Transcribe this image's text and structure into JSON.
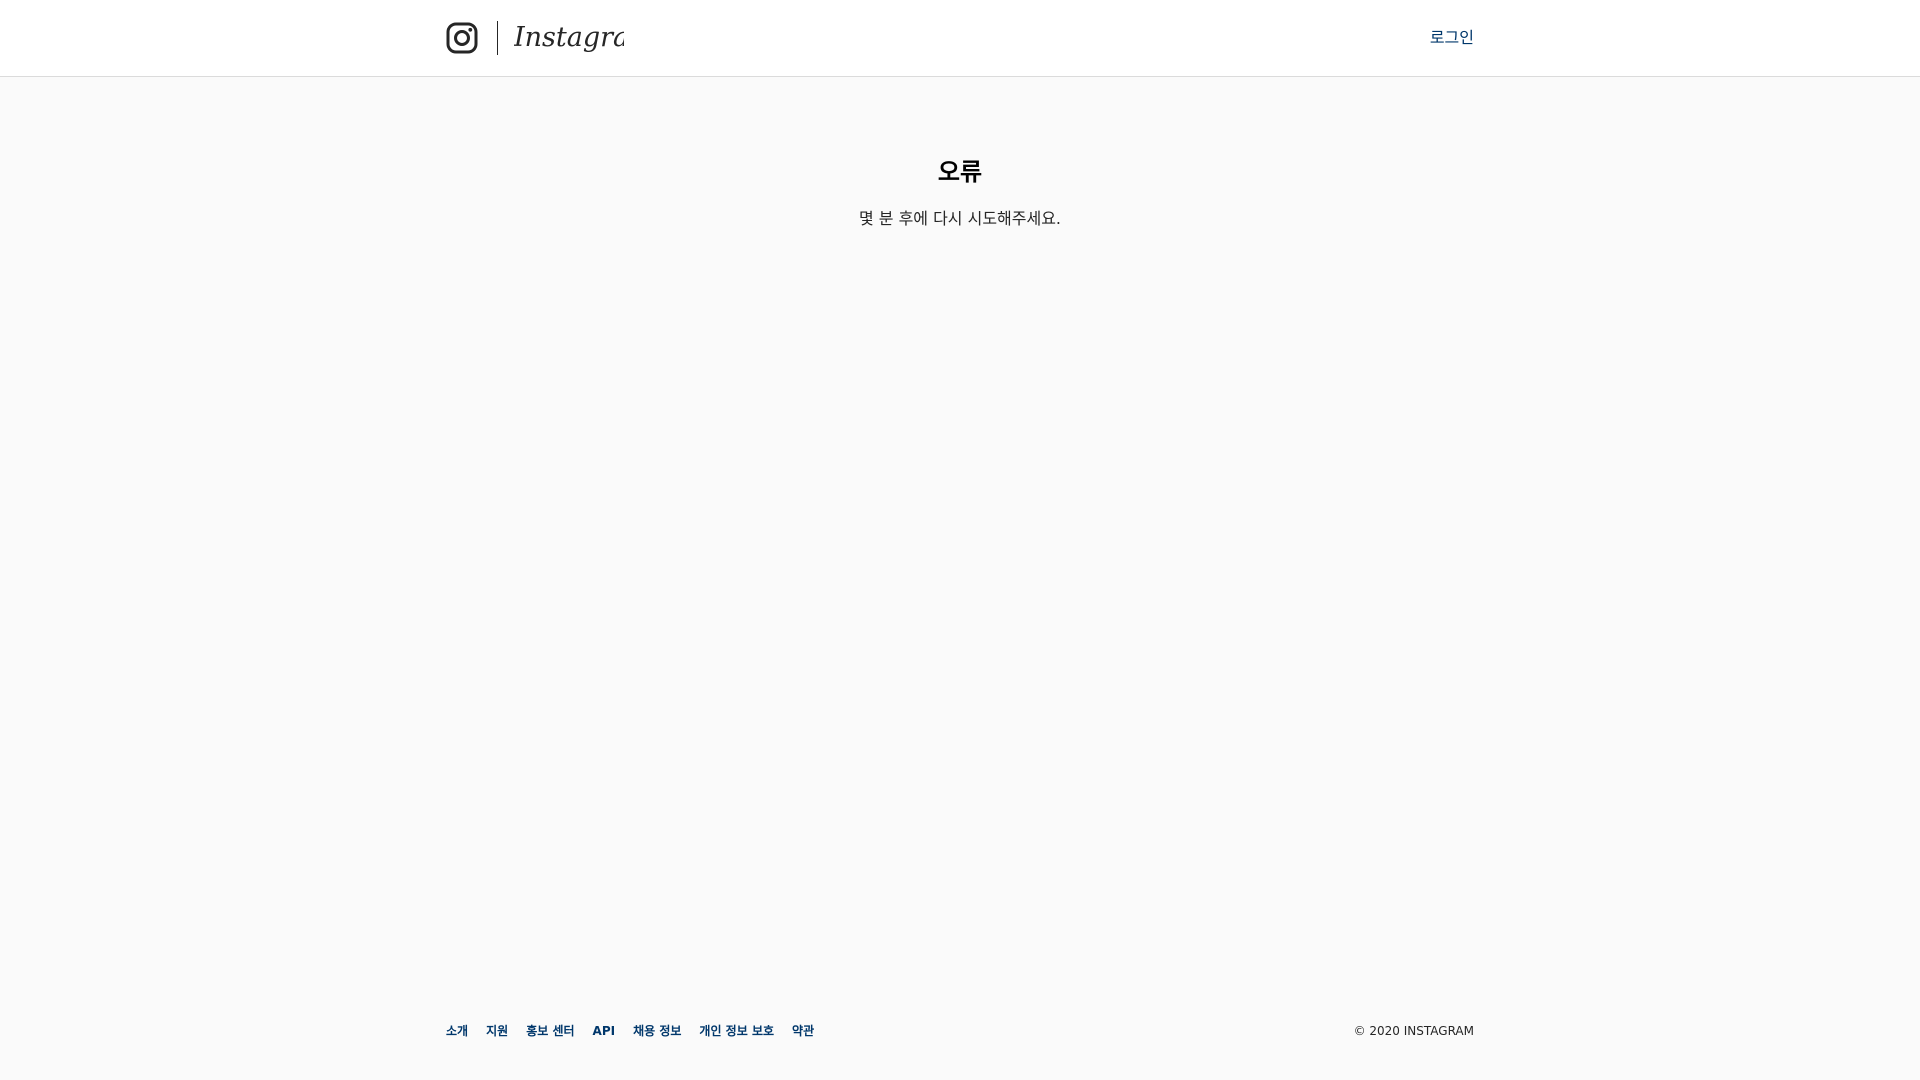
{
  "header": {
    "logo_icon": "instagram-glyph-icon",
    "wordmark": "Instagram",
    "login_label": "로그인"
  },
  "main": {
    "title": "오류",
    "message": "몇 분 후에 다시 시도해주세요."
  },
  "footer": {
    "links": [
      {
        "label": "소개"
      },
      {
        "label": "지원"
      },
      {
        "label": "홍보 센터"
      },
      {
        "label": "API"
      },
      {
        "label": "채용 정보"
      },
      {
        "label": "개인 정보 보호"
      },
      {
        "label": "약관"
      }
    ],
    "copyright": "© 2020 INSTAGRAM"
  },
  "colors": {
    "link": "#00376b",
    "background": "#fafafa",
    "header_bg": "#ffffff",
    "border": "#dbdbdb"
  }
}
